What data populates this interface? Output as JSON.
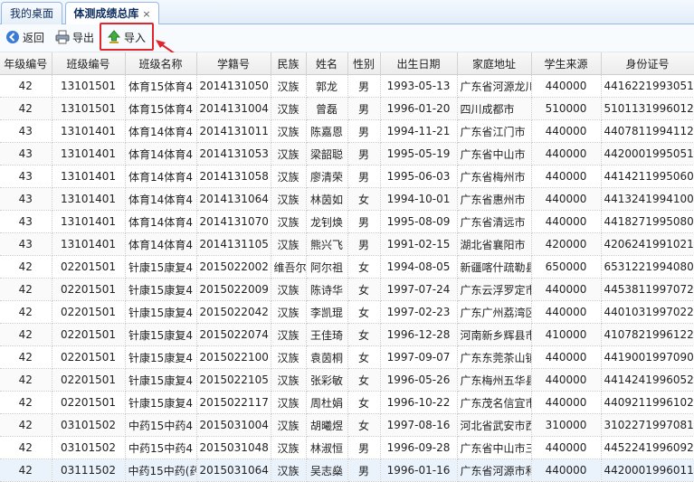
{
  "tabs": [
    {
      "label": "我的桌面"
    },
    {
      "label": "体测成绩总库",
      "close": "×"
    }
  ],
  "toolbar": {
    "back_label": "返回",
    "export_label": "导出",
    "import_label": "导入"
  },
  "columns": [
    "年级编号",
    "班级编号",
    "班级名称",
    "学籍号",
    "民族",
    "姓名",
    "性别",
    "出生日期",
    "家庭地址",
    "学生来源",
    "身份证号"
  ],
  "rows": [
    [
      "42",
      "13101501",
      "体育15体育4",
      "2014131050",
      "汉族",
      "郭龙",
      "男",
      "1993-05-13",
      "广东省河源龙川",
      "440000",
      "441622199305130"
    ],
    [
      "42",
      "13101501",
      "体育15体育4",
      "2014131004",
      "汉族",
      "曾磊",
      "男",
      "1996-01-20",
      "四川成都市",
      "510000",
      "510113199601200"
    ],
    [
      "43",
      "13101401",
      "体育14体育4",
      "2014131011",
      "汉族",
      "陈嘉恩",
      "男",
      "1994-11-21",
      "广东省江门市",
      "440000",
      "440781199411210"
    ],
    [
      "43",
      "13101401",
      "体育14体育4",
      "2014131053",
      "汉族",
      "梁韶聪",
      "男",
      "1995-05-19",
      "广东省中山市",
      "440000",
      "442000199505190"
    ],
    [
      "43",
      "13101401",
      "体育14体育4",
      "2014131058",
      "汉族",
      "廖清荣",
      "男",
      "1995-06-03",
      "广东省梅州市",
      "440000",
      "441421199506030"
    ],
    [
      "43",
      "13101401",
      "体育14体育4",
      "2014131064",
      "汉族",
      "林茵如",
      "女",
      "1994-10-01",
      "广东省惠州市",
      "440000",
      "441324199410010"
    ],
    [
      "43",
      "13101401",
      "体育14体育4",
      "2014131070",
      "汉族",
      "龙钊焕",
      "男",
      "1995-08-09",
      "广东省清远市",
      "440000",
      "441827199508090"
    ],
    [
      "43",
      "13101401",
      "体育14体育4",
      "2014131105",
      "汉族",
      "熊兴飞",
      "男",
      "1991-02-15",
      "湖北省襄阳市",
      "420000",
      "420624199102150"
    ],
    [
      "42",
      "02201501",
      "针康15康复4",
      "2015022002",
      "维吾尔",
      "阿尔祖",
      "女",
      "1994-08-05",
      "新疆喀什疏勒县",
      "650000",
      "653122199408050"
    ],
    [
      "42",
      "02201501",
      "针康15康复4",
      "2015022009",
      "汉族",
      "陈诗华",
      "女",
      "1997-07-24",
      "广东云浮罗定市",
      "440000",
      "445381199707240"
    ],
    [
      "42",
      "02201501",
      "针康15康复4",
      "2015022042",
      "汉族",
      "李凯琨",
      "女",
      "1997-02-23",
      "广东广州荔湾区",
      "440000",
      "440103199702230"
    ],
    [
      "42",
      "02201501",
      "针康15康复4",
      "2015022074",
      "汉族",
      "王佳琦",
      "女",
      "1996-12-28",
      "河南新乡辉县市",
      "410000",
      "410782199612280"
    ],
    [
      "42",
      "02201501",
      "针康15康复4",
      "2015022100",
      "汉族",
      "袁茵桐",
      "女",
      "1997-09-07",
      "广东东莞茶山镇",
      "440000",
      "441900199709070"
    ],
    [
      "42",
      "02201501",
      "针康15康复4",
      "2015022105",
      "汉族",
      "张彩敏",
      "女",
      "1996-05-26",
      "广东梅州五华县",
      "440000",
      "441424199605260"
    ],
    [
      "42",
      "02201501",
      "针康15康复4",
      "2015022117",
      "汉族",
      "周杜娟",
      "女",
      "1996-10-22",
      "广东茂名信宜市",
      "440000",
      "440921199610220"
    ],
    [
      "42",
      "03101502",
      "中药15中药4",
      "2015031004",
      "汉族",
      "胡曦煜",
      "女",
      "1997-08-16",
      "河北省武安市西",
      "310000",
      "310227199708160"
    ],
    [
      "42",
      "03101502",
      "中药15中药4",
      "2015031048",
      "汉族",
      "林淑恒",
      "男",
      "1996-09-28",
      "广东省中山市三",
      "440000",
      "445224199609280"
    ],
    [
      "42",
      "03111502",
      "中药15中药(药",
      "2015031064",
      "汉族",
      "吴志燊",
      "男",
      "1996-01-16",
      "广东省河源市和",
      "440000",
      "442000199601160"
    ]
  ]
}
